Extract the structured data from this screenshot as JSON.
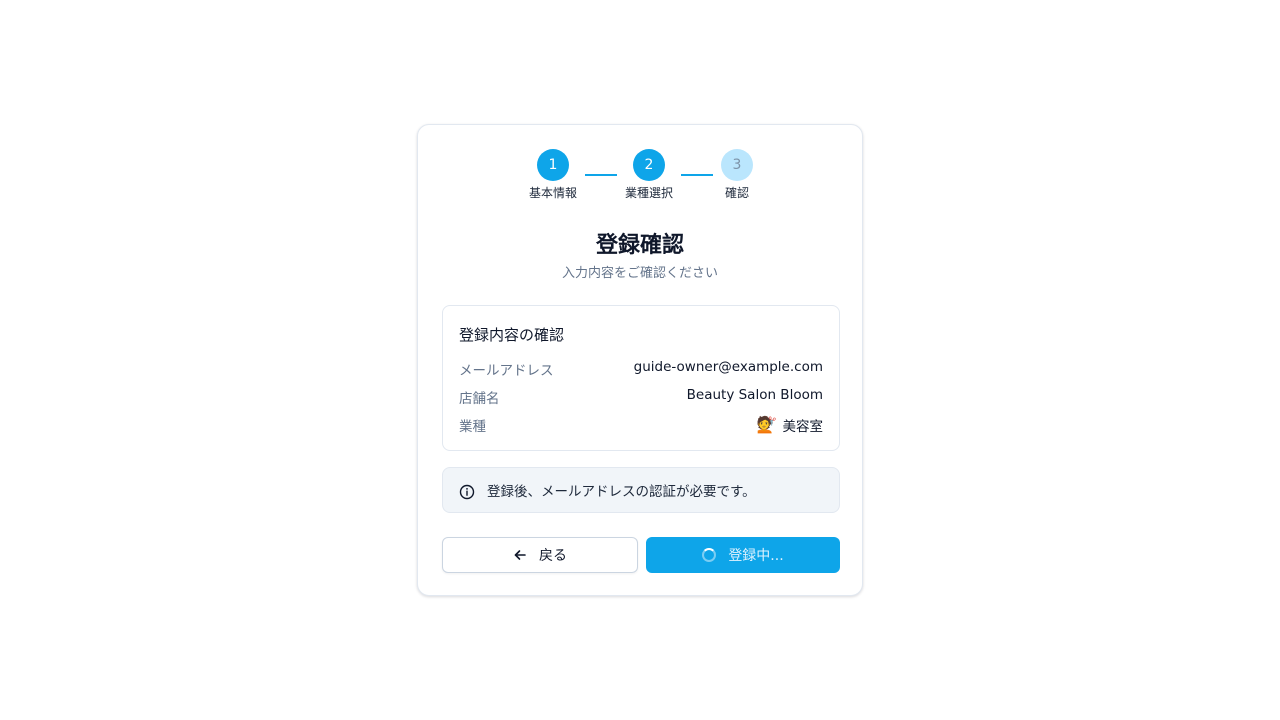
{
  "stepper": {
    "steps": [
      {
        "number": "1",
        "label": "基本情報",
        "state": "complete"
      },
      {
        "number": "2",
        "label": "業種選択",
        "state": "complete"
      },
      {
        "number": "3",
        "label": "確認",
        "state": "current"
      }
    ]
  },
  "page": {
    "title": "登録確認",
    "subtitle": "入力内容をご確認ください"
  },
  "summary": {
    "heading": "登録内容の確認",
    "rows": [
      {
        "label": "メールアドレス",
        "value": "guide-owner@example.com"
      },
      {
        "label": "店舗名",
        "value": "Beauty Salon Bloom"
      },
      {
        "label": "業種",
        "value": "美容室",
        "emoji": "💇"
      }
    ]
  },
  "notice": {
    "icon": "info-icon",
    "text": "登録後、メールアドレスの認証が必要です。"
  },
  "actions": {
    "back_label": "戻る",
    "back_icon": "arrow-left-icon",
    "submit_label": "登録中...",
    "submit_icon": "spinner-icon"
  },
  "colors": {
    "accent": "#0ea5e9",
    "accent_light": "#bae6fd",
    "muted_text": "#64748b",
    "border": "#e2e8f0"
  }
}
